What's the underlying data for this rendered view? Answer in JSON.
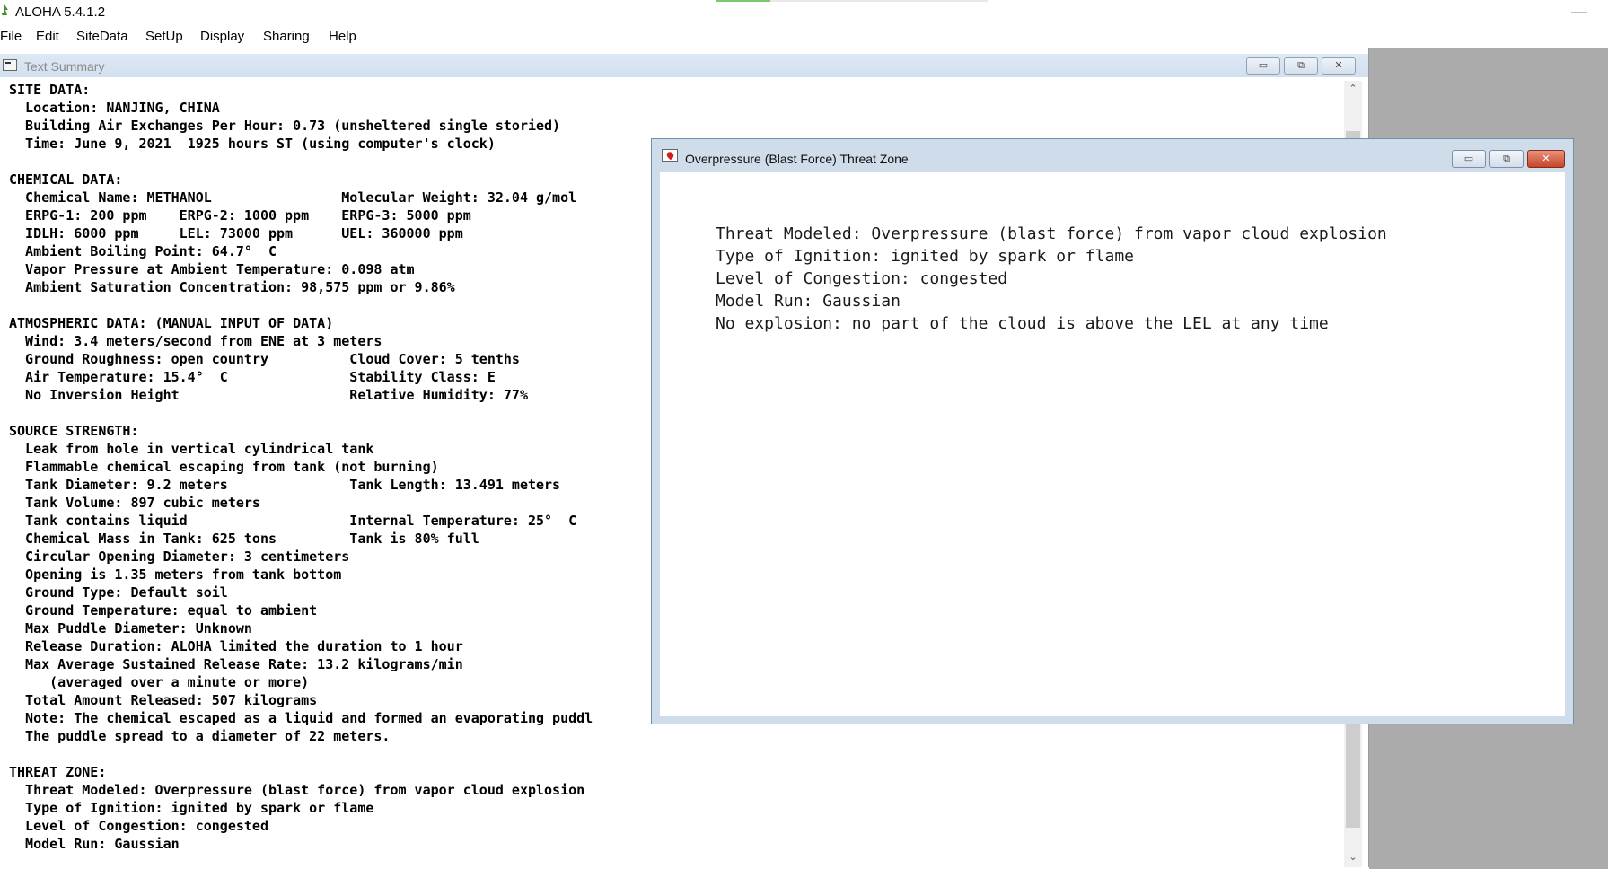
{
  "app": {
    "title": "ALOHA 5.4.1.2",
    "minimize_glyph": "—",
    "progress": 0.2
  },
  "menu": [
    "File",
    "Edit",
    "SiteData",
    "SetUp",
    "Display",
    "Sharing",
    "Help"
  ],
  "text_summary": {
    "title": "Text Summary",
    "buttons": {
      "minimize": "▭",
      "restore": "⧉",
      "close": "✕"
    },
    "lines": [
      "SITE DATA:",
      "  Location: NANJING, CHINA",
      "  Building Air Exchanges Per Hour: 0.73 (unsheltered single storied)",
      "  Time: June 9, 2021  1925 hours ST (using computer's clock)",
      "",
      "CHEMICAL DATA:",
      "  Chemical Name: METHANOL                Molecular Weight: 32.04 g/mol",
      "  ERPG-1: 200 ppm    ERPG-2: 1000 ppm    ERPG-3: 5000 ppm",
      "  IDLH: 6000 ppm     LEL: 73000 ppm      UEL: 360000 ppm",
      "  Ambient Boiling Point: 64.7°  C",
      "  Vapor Pressure at Ambient Temperature: 0.098 atm",
      "  Ambient Saturation Concentration: 98,575 ppm or 9.86%",
      "",
      "ATMOSPHERIC DATA: (MANUAL INPUT OF DATA)",
      "  Wind: 3.4 meters/second from ENE at 3 meters",
      "  Ground Roughness: open country          Cloud Cover: 5 tenths",
      "  Air Temperature: 15.4°  C               Stability Class: E",
      "  No Inversion Height                     Relative Humidity: 77%",
      "",
      "SOURCE STRENGTH:",
      "  Leak from hole in vertical cylindrical tank",
      "  Flammable chemical escaping from tank (not burning)",
      "  Tank Diameter: 9.2 meters               Tank Length: 13.491 meters",
      "  Tank Volume: 897 cubic meters",
      "  Tank contains liquid                    Internal Temperature: 25°  C",
      "  Chemical Mass in Tank: 625 tons         Tank is 80% full",
      "  Circular Opening Diameter: 3 centimeters",
      "  Opening is 1.35 meters from tank bottom",
      "  Ground Type: Default soil",
      "  Ground Temperature: equal to ambient",
      "  Max Puddle Diameter: Unknown",
      "  Release Duration: ALOHA limited the duration to 1 hour",
      "  Max Average Sustained Release Rate: 13.2 kilograms/min",
      "     (averaged over a minute or more)",
      "  Total Amount Released: 507 kilograms",
      "  Note: The chemical escaped as a liquid and formed an evaporating puddl",
      "  The puddle spread to a diameter of 22 meters.",
      "",
      "THREAT ZONE:",
      "  Threat Modeled: Overpressure (blast force) from vapor cloud explosion",
      "  Type of Ignition: ignited by spark or flame",
      "  Level of Congestion: congested",
      "  Model Run: Gaussian"
    ]
  },
  "overpressure": {
    "title": "Overpressure (Blast Force) Threat Zone",
    "buttons": {
      "minimize": "▭",
      "restore": "⧉",
      "close": "✕"
    },
    "lines": [
      "Threat Modeled: Overpressure (blast force) from vapor cloud explosion",
      "Type of Ignition: ignited by spark or flame",
      "Level of Congestion: congested",
      "Model Run: Gaussian",
      "No explosion: no part of the cloud is above the LEL at any time"
    ]
  },
  "scrollbar": {
    "up_glyph": "⌃",
    "down_glyph": "⌄"
  }
}
